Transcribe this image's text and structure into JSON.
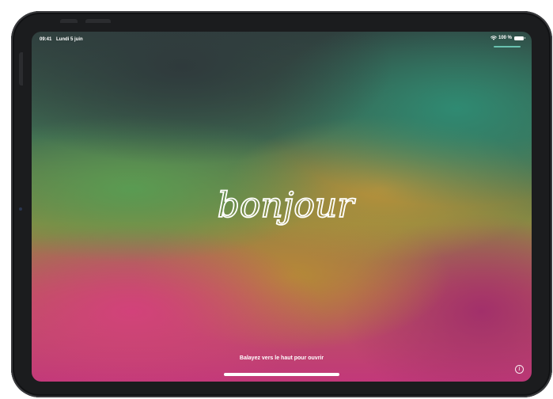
{
  "status_bar": {
    "time": "09:41",
    "date": "Lundi 5 juin",
    "battery_text": "100 %",
    "icons": [
      "wifi-icon",
      "battery-icon"
    ]
  },
  "lock_screen": {
    "greeting": "bonjour",
    "unlock_hint": "Balayez vers le haut pour ouvrir",
    "info_icon": "info-icon",
    "info_glyph": "i"
  },
  "colors": {
    "bezel": "#1b1c1e",
    "text": "#ffffff",
    "accent_teal": "#2f8a72",
    "accent_magenta": "#c2387a"
  }
}
